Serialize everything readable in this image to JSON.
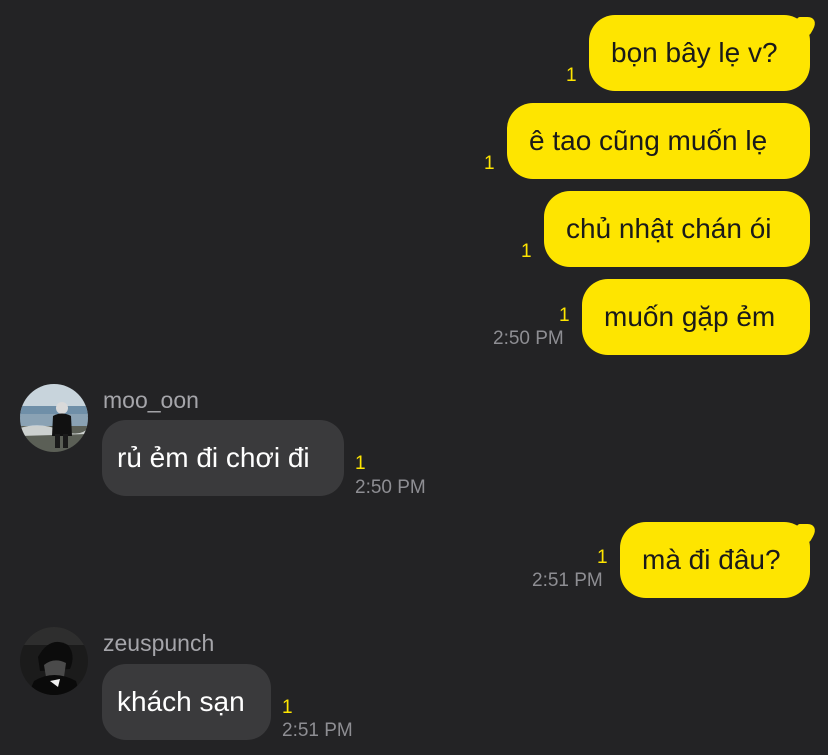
{
  "messages": [
    {
      "direction": "outgoing",
      "text": "bọn bây lẹ v?",
      "unread": "1"
    },
    {
      "direction": "outgoing",
      "text": "ê tao cũng muốn lẹ",
      "unread": "1"
    },
    {
      "direction": "outgoing",
      "text": "chủ nhật chán ói",
      "unread": "1"
    },
    {
      "direction": "outgoing",
      "text": "muốn gặp ẻm",
      "unread": "1",
      "time": "2:50 PM"
    },
    {
      "direction": "incoming",
      "sender": "moo_oon",
      "avatar": "beach-photo-avatar",
      "text": "rủ ẻm đi chơi đi",
      "unread": "1",
      "time": "2:50 PM"
    },
    {
      "direction": "outgoing",
      "text": "mà đi đâu?",
      "unread": "1",
      "time": "2:51 PM"
    },
    {
      "direction": "incoming",
      "sender": "zeuspunch",
      "avatar": "dark-portrait-avatar",
      "text": "khách sạn",
      "unread": "1",
      "time": "2:51 PM"
    }
  ],
  "colors": {
    "background": "#232325",
    "outgoing_bubble": "#FEE500",
    "incoming_bubble": "#3A3A3C",
    "unread_count": "#FEE500",
    "timestamp": "#8E8E93"
  }
}
